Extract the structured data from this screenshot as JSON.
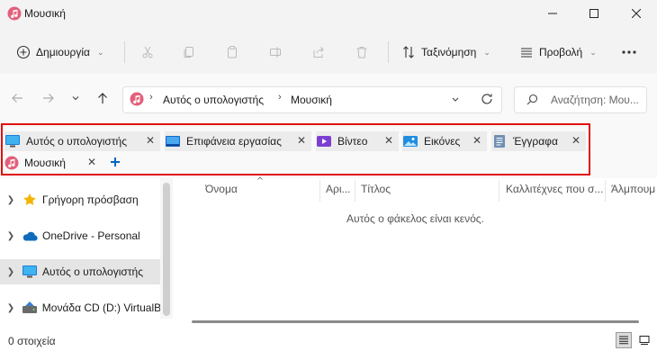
{
  "window": {
    "title": "Μουσική"
  },
  "commands": {
    "new_label": "Δημιουργία",
    "sort_label": "Ταξινόμηση",
    "view_label": "Προβολή"
  },
  "address": {
    "segments": [
      "Αυτός ο υπολογιστής",
      "Μουσική"
    ]
  },
  "search": {
    "placeholder": "Αναζήτηση: Μου..."
  },
  "tabs": [
    {
      "label": "Αυτός ο υπολογιστής",
      "icon": "monitor-icon"
    },
    {
      "label": "Επιφάνεια εργασίας",
      "icon": "desktop-icon"
    },
    {
      "label": "Βίντεο",
      "icon": "video-icon"
    },
    {
      "label": "Εικόνες",
      "icon": "pictures-icon"
    },
    {
      "label": "Έγγραφα",
      "icon": "documents-icon"
    },
    {
      "label": "Μουσική",
      "icon": "music-icon"
    }
  ],
  "sidebar": {
    "items": [
      {
        "label": "Γρήγορη πρόσβαση",
        "icon": "star-icon"
      },
      {
        "label": "OneDrive - Personal",
        "icon": "cloud-icon"
      },
      {
        "label": "Αυτός ο υπολογιστής",
        "icon": "monitor-icon",
        "selected": true
      },
      {
        "label": "Μονάδα CD (D:) VirtualB",
        "icon": "cd-drive-icon"
      }
    ]
  },
  "columns": [
    "Όνομα",
    "Αρι...",
    "Τίτλος",
    "Καλλιτέχνες που σ...",
    "Άλμπουμ"
  ],
  "main": {
    "empty_message": "Αυτός ο φάκελος είναι κενός."
  },
  "status": {
    "items_count": "0 στοιχεία"
  },
  "colors": {
    "accent": "#0067c0",
    "outline": "#e01010"
  }
}
